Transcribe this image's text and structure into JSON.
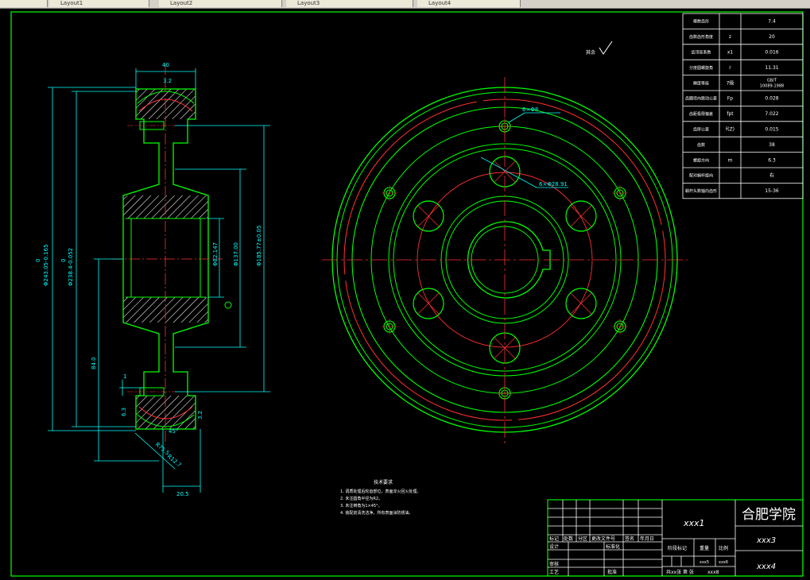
{
  "window": {
    "tabs": [
      {
        "label": ""
      },
      {
        "label": "Layout1"
      },
      {
        "label": "Layout2"
      },
      {
        "label": "Layout3"
      },
      {
        "label": "Layout4"
      }
    ]
  },
  "roughness_note": "其余",
  "dims": {
    "top_width": "40",
    "chamfer_small": "3.2",
    "dia_outer": "Φ243.05-0.165",
    "dia_root": "Φ238.4-0.052",
    "dia_hole_circle": "Φ185.77±0.05",
    "dia_bore": "Φ82.147",
    "dia_hub": "Φ137.00",
    "left_height": "84.0",
    "left_small": "1",
    "left_chamfer": "6.3",
    "bottom_r1": "R75.5",
    "bottom_r2": "R12.7",
    "bottom_angle": "45°",
    "right_small": "3.2",
    "bottom_width": "20.5",
    "upper_zero": "0",
    "lower_zero": "0"
  },
  "front_labels": {
    "hole_small": "6×Φ8",
    "hole_large": "6×Φ28.91"
  },
  "param_table": [
    {
      "name": "模数齿形",
      "sym": "",
      "val": "7.4"
    },
    {
      "name": "齿数齿形角度",
      "sym": "z",
      "val": "20"
    },
    {
      "name": "齿顶高系数",
      "sym": "x1",
      "val": "0.016"
    },
    {
      "name": "分度圆螺旋角",
      "sym": "r",
      "val": "11.31"
    },
    {
      "name": "精度等级",
      "sym": "7级",
      "val": "GB/T 10089-1988"
    },
    {
      "name": "齿圈径向跳动公差",
      "sym": "Fp",
      "val": "0.028"
    },
    {
      "name": "齿距极限偏差",
      "sym": "fpt",
      "val": "7.022"
    },
    {
      "name": "齿厚公差",
      "sym": "f(Z)",
      "val": "0.015"
    },
    {
      "name": "齿数",
      "sym": "",
      "val": "38"
    },
    {
      "name": "螺旋方向",
      "sym": "m",
      "val": "6.3"
    },
    {
      "name": "配对蜗杆旋向",
      "sym": "",
      "val": "右"
    },
    {
      "name": "蜗杆头数轴向齿形",
      "sym": "",
      "val": "15-36"
    }
  ],
  "notes": {
    "title": "技术要求",
    "lines": [
      "1. 调质处理后轮齿部位，表面淬火回火处理。",
      "2. 未注圆角半径为R2。",
      "3. 未注倒角为1×45°。",
      "4. 装配前清洗洁净，所有表面涂防锈油。"
    ]
  },
  "title_block": {
    "school": "合肥学院",
    "part_name": "xxx1",
    "part_number": "xxx3",
    "material": "xxx4",
    "scale_val": "xxx6",
    "weight_val": "xxx5",
    "sheets_text": "共xx张 第 张",
    "sheet_code": "xxx8",
    "h_mark": "标记",
    "h_count": "处数",
    "h_zone": "分区",
    "h_doc": "更改文件号",
    "h_sign": "签名",
    "h_date": "年月日",
    "design": "设计",
    "standard": "标准化",
    "stage_mark": "阶段标记",
    "weight": "重量",
    "scale": "比例",
    "review": "审核",
    "process": "工艺",
    "approve": "批准"
  }
}
